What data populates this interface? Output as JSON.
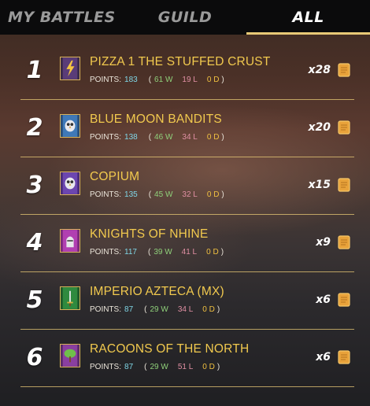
{
  "tabs": [
    {
      "label": "MY BATTLES",
      "active": false
    },
    {
      "label": "GUILD",
      "active": false
    },
    {
      "label": "ALL",
      "active": true
    }
  ],
  "accent_color": "#e8c976",
  "guilds": [
    {
      "rank": "1",
      "name": "PIZZA 1 THE STUFFED CRUST",
      "points_label": "POINTS:",
      "points": "183",
      "open": "(",
      "wins": "61 W",
      "losses": "19 L",
      "draws": "0 D",
      "close": ")",
      "multiplier": "x28",
      "banner_icon": "lightning-banner-icon"
    },
    {
      "rank": "2",
      "name": "BLUE MOON BANDITS",
      "points_label": "POINTS:",
      "points": "138",
      "open": "(",
      "wins": "46 W",
      "losses": "34 L",
      "draws": "0 D",
      "close": ")",
      "multiplier": "x20",
      "banner_icon": "owl-banner-icon"
    },
    {
      "rank": "3",
      "name": "COPIUM",
      "points_label": "POINTS:",
      "points": "135",
      "open": "(",
      "wins": "45 W",
      "losses": "32 L",
      "draws": "0 D",
      "close": ")",
      "multiplier": "x15",
      "banner_icon": "owl-banner-icon"
    },
    {
      "rank": "4",
      "name": "KNIGHTS OF NHINE",
      "points_label": "POINTS:",
      "points": "117",
      "open": "(",
      "wins": "39 W",
      "losses": "41 L",
      "draws": "0 D",
      "close": ")",
      "multiplier": "x9",
      "banner_icon": "knight-banner-icon"
    },
    {
      "rank": "5",
      "name": "IMPERIO AZTECA (MX)",
      "points_label": "POINTS:",
      "points": "87",
      "open": "(",
      "wins": "29 W",
      "losses": "34 L",
      "draws": "0 D",
      "close": ")",
      "multiplier": "x6",
      "banner_icon": "sword-banner-icon"
    },
    {
      "rank": "6",
      "name": "RACOONS OF THE NORTH",
      "points_label": "POINTS:",
      "points": "87",
      "open": "(",
      "wins": "29 W",
      "losses": "51 L",
      "draws": "0 D",
      "close": ")",
      "multiplier": "x6",
      "banner_icon": "tree-banner-icon"
    }
  ]
}
